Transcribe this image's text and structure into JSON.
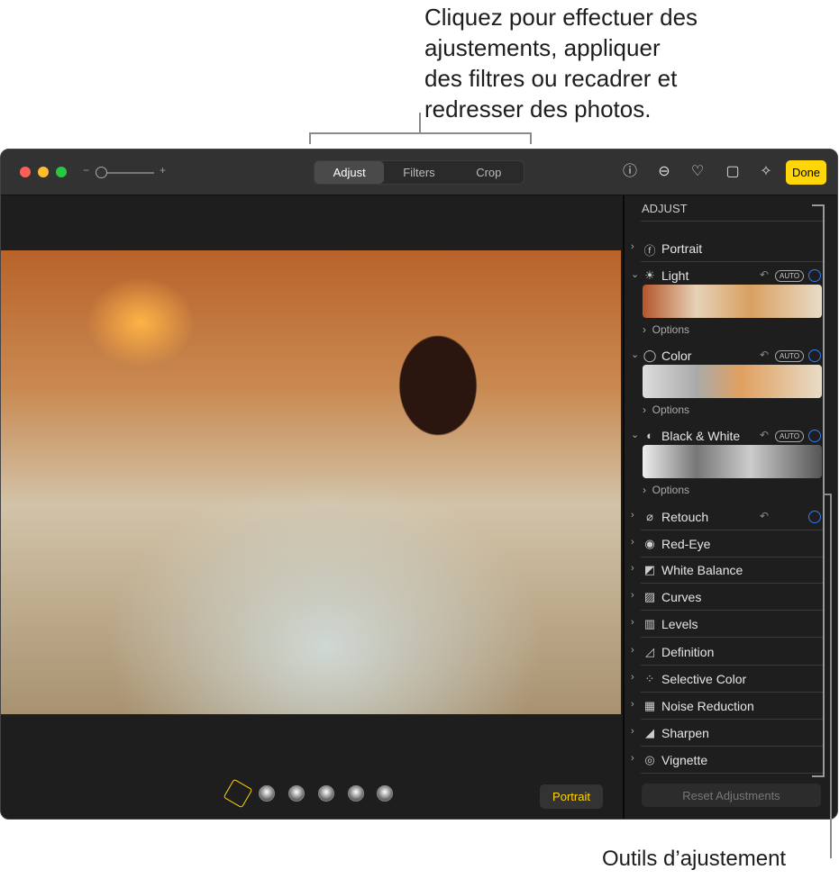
{
  "callouts": {
    "top": [
      "Cliquez pour effectuer des",
      "ajustements, appliquer",
      "des filtres ou recadrer et",
      "redresser des photos."
    ],
    "bottom": "Outils d’ajustement"
  },
  "toolbar": {
    "zoom_minus": "−",
    "zoom_plus": "+",
    "zoom_level": 0.1,
    "tabs": [
      "Adjust",
      "Filters",
      "Crop"
    ],
    "active_tab": "Adjust",
    "icons": [
      "info-icon",
      "more-icon",
      "heart-icon",
      "rotate-icon",
      "magic-wand-icon"
    ],
    "done": "Done",
    "done_color": "#ffd60a"
  },
  "sidebar": {
    "heading": "ADJUST",
    "accent": "#2f7bf5",
    "items": [
      {
        "label": "Portrait",
        "icon": "portrait-f-icon"
      },
      {
        "label": "Light",
        "icon": "sun-icon",
        "auto": "AUTO",
        "options": "Options"
      },
      {
        "label": "Color",
        "icon": "color-ring-icon",
        "auto": "AUTO",
        "options": "Options"
      },
      {
        "label": "Black & White",
        "icon": "half-circle-icon",
        "auto": "AUTO",
        "options": "Options"
      },
      {
        "label": "Retouch",
        "icon": "bandage-icon"
      },
      {
        "label": "Red-Eye",
        "icon": "eye-icon"
      },
      {
        "label": "White Balance",
        "icon": "white-balance-icon"
      },
      {
        "label": "Curves",
        "icon": "curves-icon"
      },
      {
        "label": "Levels",
        "icon": "levels-icon"
      },
      {
        "label": "Definition",
        "icon": "definition-icon"
      },
      {
        "label": "Selective Color",
        "icon": "dots-icon"
      },
      {
        "label": "Noise Reduction",
        "icon": "noise-icon"
      },
      {
        "label": "Sharpen",
        "icon": "sharpen-icon"
      },
      {
        "label": "Vignette",
        "icon": "vignette-icon"
      }
    ],
    "reset": "Reset Adjustments"
  },
  "bottom": {
    "portrait_button": "Portrait",
    "portrait_color": "#ffd60a"
  }
}
